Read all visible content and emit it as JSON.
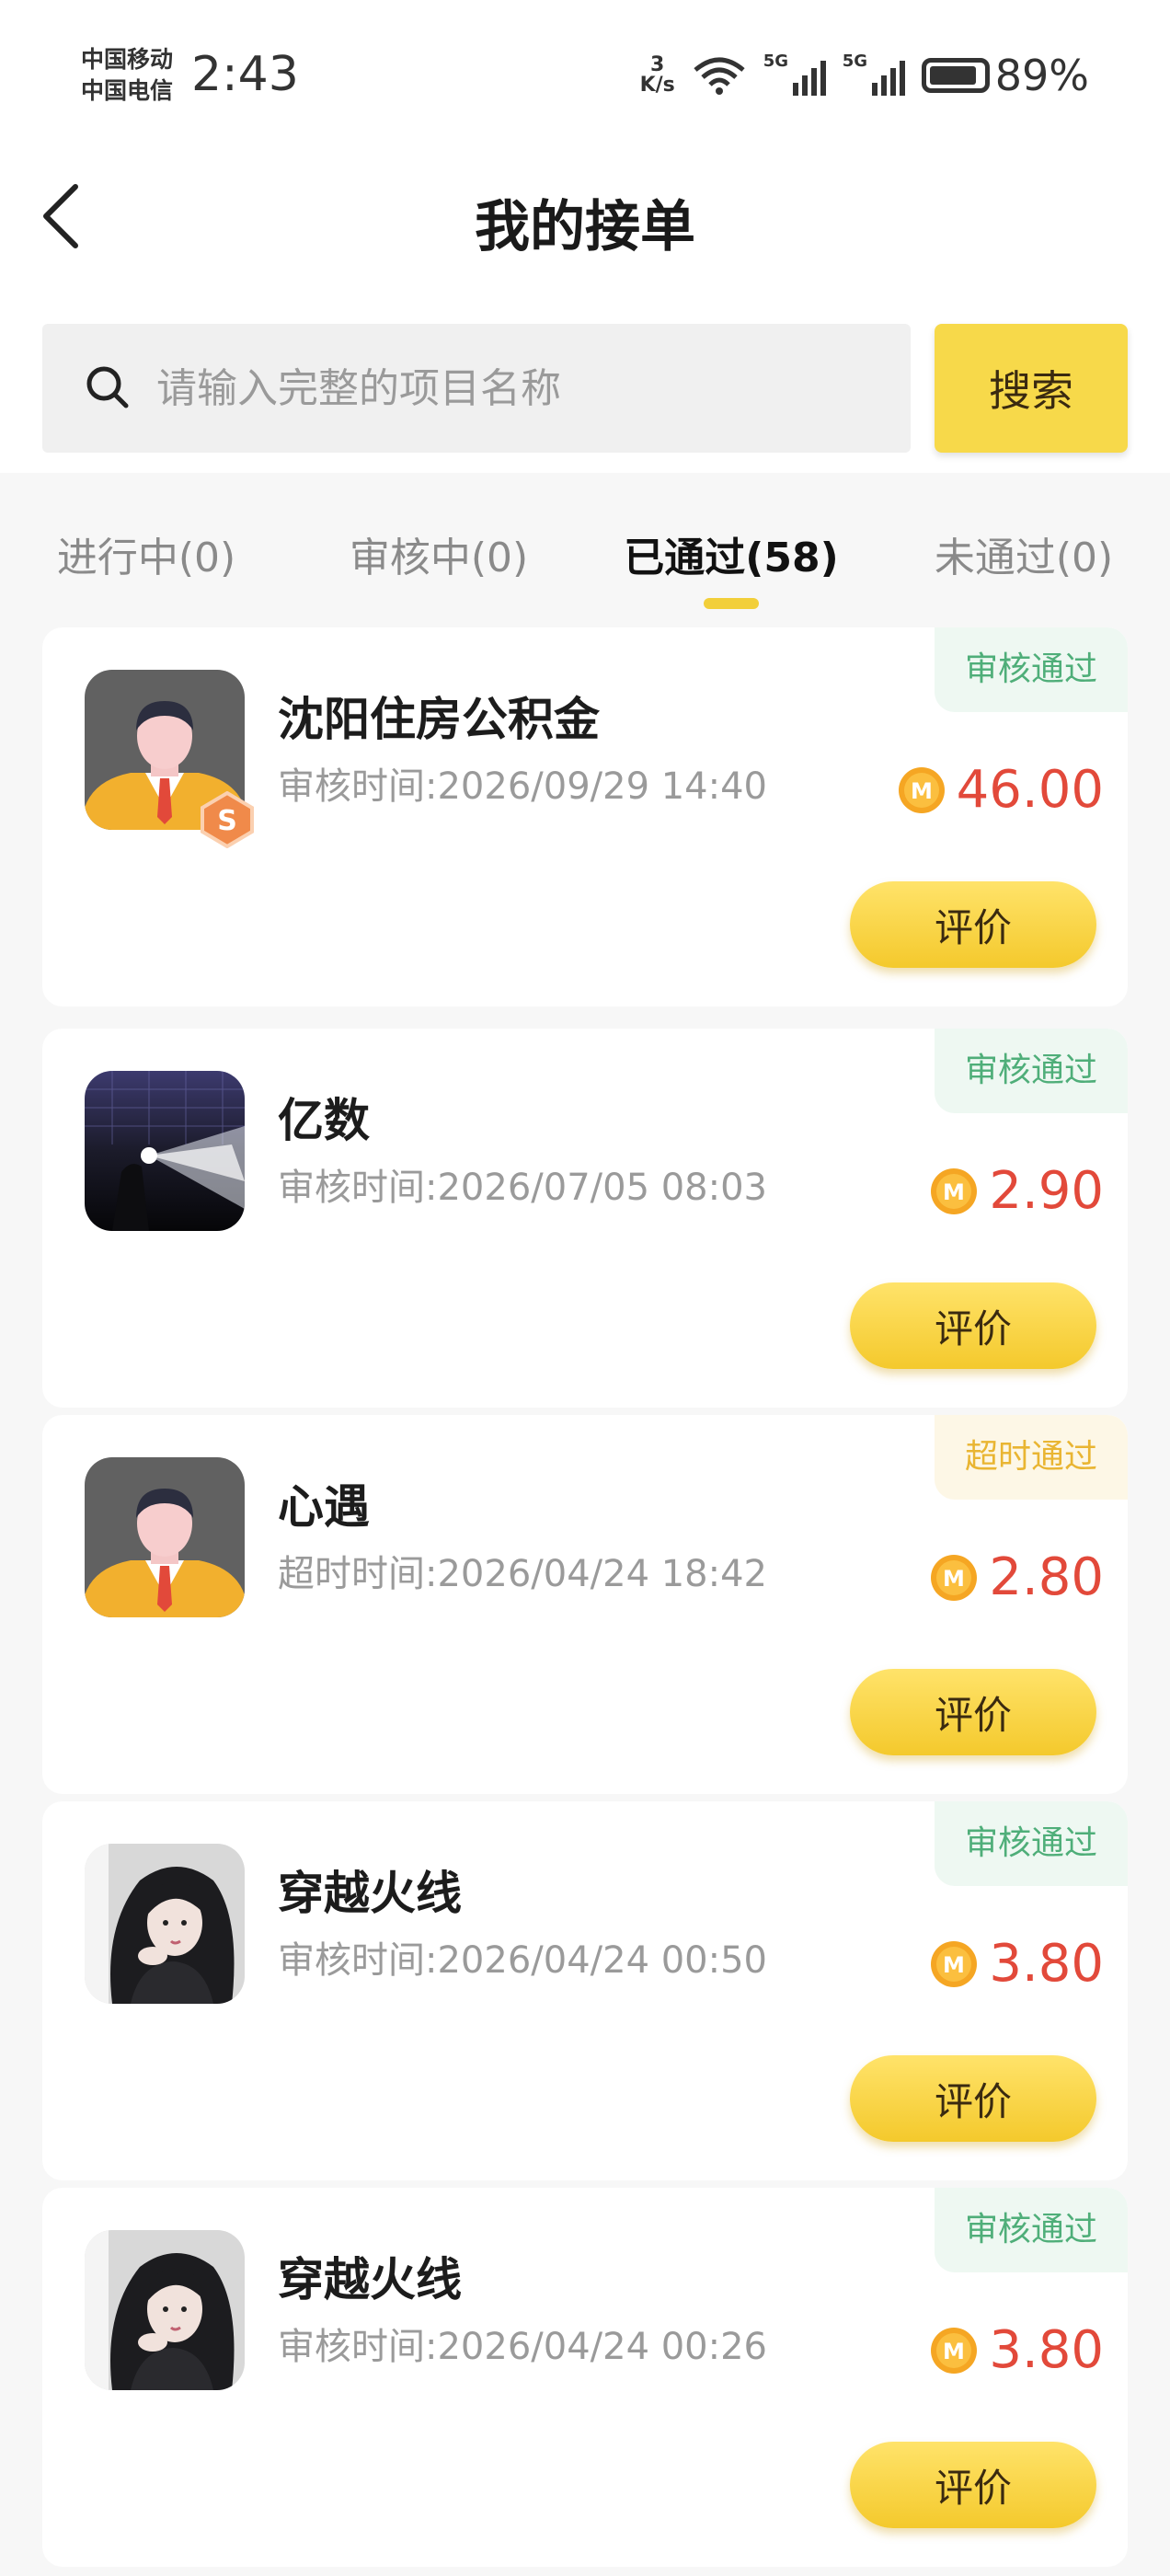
{
  "status_bar": {
    "carrier1": "中国移动",
    "carrier2": "中国电信",
    "time": "2:43",
    "speed_value": "3",
    "speed_unit": "K/s",
    "signal1_label": "5G",
    "signal2_label": "5G",
    "battery": "89%"
  },
  "header": {
    "title": "我的接单"
  },
  "search": {
    "placeholder": "请输入完整的项目名称",
    "value": "",
    "button": "搜索"
  },
  "tabs": [
    {
      "label": "进行中(0)",
      "active": false
    },
    {
      "label": "审核中(0)",
      "active": false
    },
    {
      "label": "已通过(58)",
      "active": true
    },
    {
      "label": "未通过(0)",
      "active": false
    }
  ],
  "orders": [
    {
      "name": "沈阳住房公积金",
      "time": "审核时间:2026/09/29 14:40",
      "status": "审核通过",
      "status_kind": "pass",
      "amount": "46.00",
      "button": "评价",
      "avatar": "avatar-man-icon"
    },
    {
      "name": "亿数",
      "time": "审核时间:2026/07/05 08:03",
      "status": "审核通过",
      "status_kind": "pass",
      "amount": "2.90",
      "button": "评价",
      "avatar": "avatar-light-photo"
    },
    {
      "name": "心遇",
      "time": "超时时间:2026/04/24 18:42",
      "status": "超时通过",
      "status_kind": "overtime",
      "amount": "2.80",
      "button": "评价",
      "avatar": "avatar-man-icon"
    },
    {
      "name": "穿越火线",
      "time": "审核时间:2026/04/24 00:50",
      "status": "审核通过",
      "status_kind": "pass",
      "amount": "3.80",
      "button": "评价",
      "avatar": "avatar-girl-photo"
    },
    {
      "name": "穿越火线",
      "time": "审核时间:2026/04/24 00:26",
      "status": "审核通过",
      "status_kind": "pass",
      "amount": "3.80",
      "button": "评价",
      "avatar": "avatar-girl-photo"
    }
  ],
  "colors": {
    "accent": "#f7d94a",
    "price": "#e2493a",
    "pass": "#4fae79",
    "overtime": "#e9b532"
  }
}
